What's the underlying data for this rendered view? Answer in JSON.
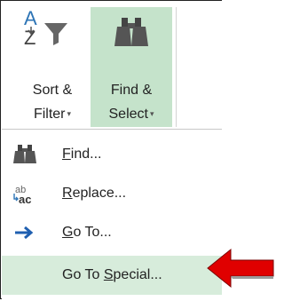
{
  "ribbon": {
    "sort_filter": {
      "line1": "Sort &",
      "line2": "Filter",
      "icon": "sort-az-filter-icon"
    },
    "find_select": {
      "line1": "Find &",
      "line2": "Select",
      "icon": "binoculars-icon"
    },
    "dropdown_caret": "▾"
  },
  "menu": {
    "items": [
      {
        "prefix": "",
        "accel": "F",
        "suffix": "ind...",
        "icon": "binoculars-icon"
      },
      {
        "prefix": "",
        "accel": "R",
        "suffix": "eplace...",
        "icon": "replace-ab-ac-icon"
      },
      {
        "prefix": "",
        "accel": "G",
        "suffix": "o To...",
        "icon": "arrow-right-icon"
      },
      {
        "prefix": "Go To ",
        "accel": "S",
        "suffix": "pecial...",
        "icon": ""
      }
    ],
    "highlighted_item": "Go To Special..."
  },
  "colors": {
    "ribbon_active": "#c5e3cb",
    "menu_highlight": "#d7ecdb",
    "callout_arrow": "#e00000",
    "sort_a": "#2e75b6",
    "arrow_icon": "#1f5fb0"
  }
}
